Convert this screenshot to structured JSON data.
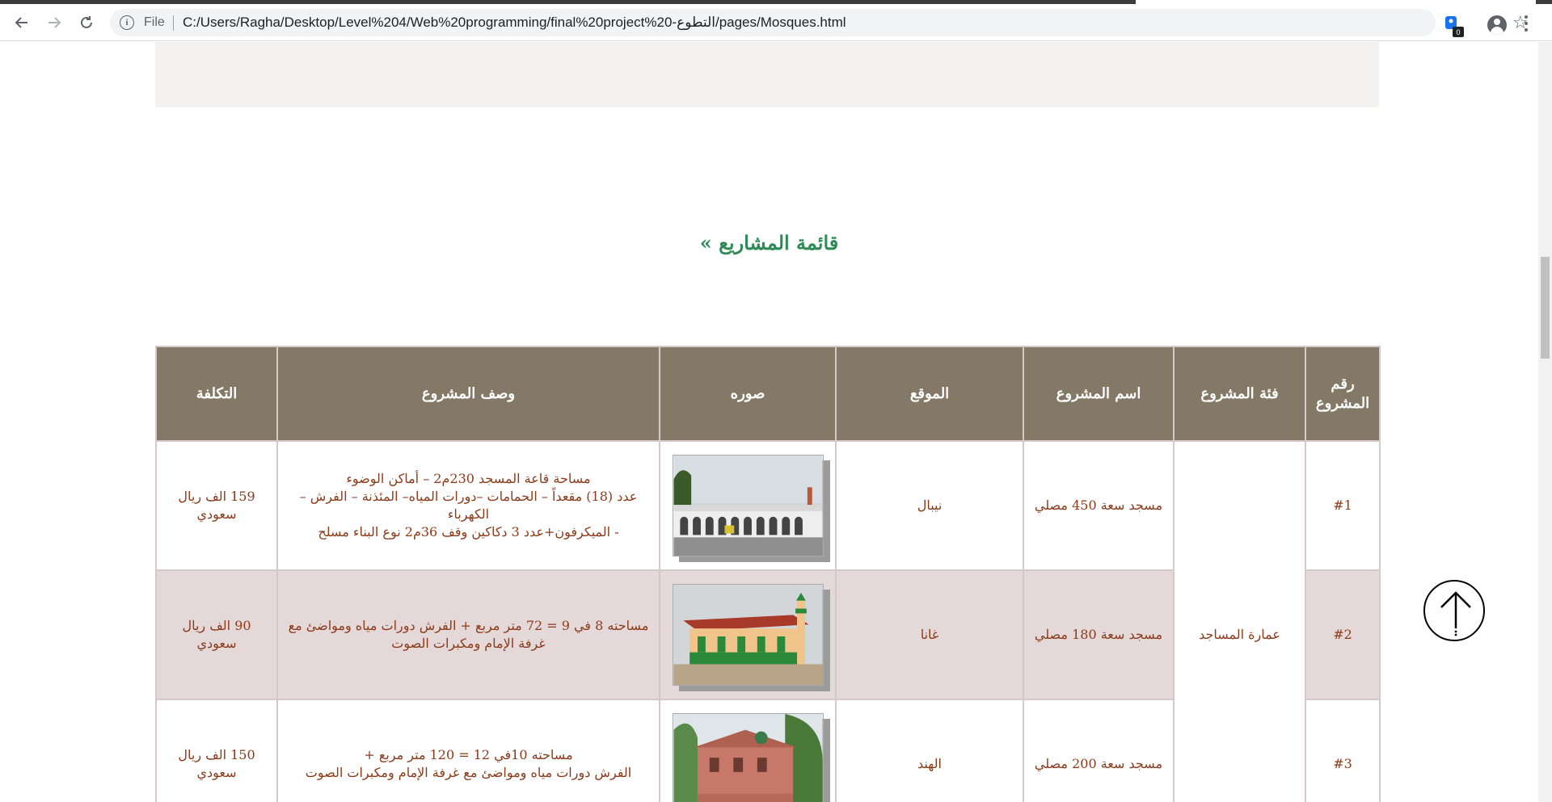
{
  "browser": {
    "url_scheme": "File",
    "url": "C:/Users/Ragha/Desktop/Level%204/Web%20programming/final%20project%20-التطوع/pages/Mosques.html",
    "extension_badge": "0"
  },
  "section": {
    "title": "قائمة المشاريع »"
  },
  "table": {
    "headers": {
      "number": "رقم المشروع",
      "category": "فئة المشروع",
      "name": "اسم المشروع",
      "location": "الموقع",
      "image": "صوره",
      "description": "وصف المشروع",
      "cost": "التكلفة"
    },
    "category": "عمارة المساجد",
    "rows": [
      {
        "number": "#1",
        "name": "مسجد سعة 450 مصلي",
        "location": "نيبال",
        "description": "مساحة قاعة المسجد 230م2 – أماكن الوضوء\nعدد (18) مقعداً – الحمامات –دورات المياه– المئذنة – الفرش – الكهرباء\n- الميكرفون+عدد 3 دكاكين وقف 36م2 نوع البناء مسلح",
        "cost": "159 الف ريال سعودي"
      },
      {
        "number": "#2",
        "name": "مسجد سعة 180 مصلي",
        "location": "غانا",
        "description": "مساحته 8 في 9 = 72 متر مربع + الفرش دورات مياه ومواضئ مع غرفة الإمام ومكبرات الصوت",
        "cost": "90 الف ريال سعودي"
      },
      {
        "number": "#3",
        "name": "مسجد سعة 200 مصلي",
        "location": "الهند",
        "description": "مساحته 10في 12 = 120 متر مربع +\nالفرش دورات مياه ومواضئ مع غرفة الإمام ومكبرات الصوت",
        "cost": "150 الف ريال سعودي"
      }
    ]
  },
  "colors": {
    "title": "#2e8b57",
    "header_bg": "#847866",
    "cell_text": "#8b3a1a",
    "alt_row": "#e4d8d8"
  }
}
